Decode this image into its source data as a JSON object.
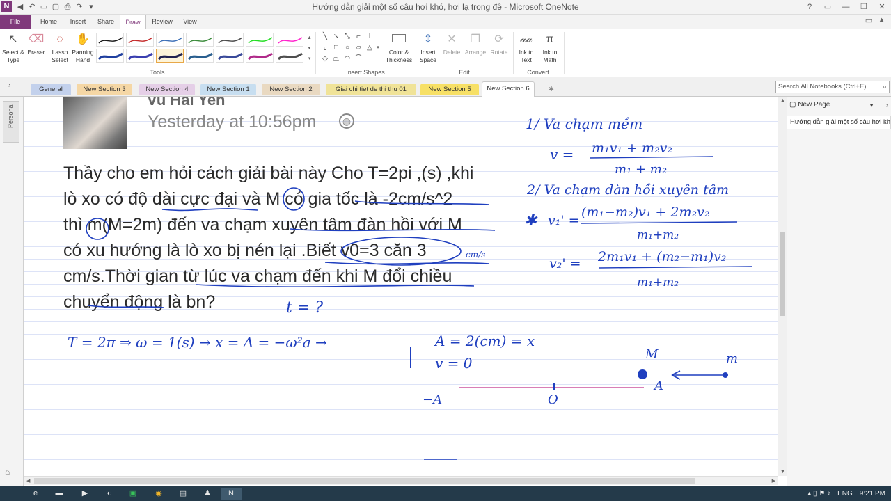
{
  "window": {
    "title": "Hướng dẫn giải một số câu hơi khó, hơi lạ trong đề - Microsoft OneNote",
    "app_logo": "N",
    "buttons": {
      "help": "?",
      "minimize": "—",
      "restore": "❐",
      "close": "✕"
    }
  },
  "quick_access": [
    "back-icon",
    "undo-icon",
    "dock-icon",
    "fullpage-icon",
    "print-icon",
    "redo-icon",
    "customize-icon"
  ],
  "ribbon_tabs": [
    "File",
    "Home",
    "Insert",
    "Share",
    "Draw",
    "Review",
    "View"
  ],
  "active_tab": "Draw",
  "ribbon": {
    "tools": {
      "select_type": "Select & Type",
      "eraser": "Eraser",
      "lasso_select": "Lasso Select",
      "panning_hand": "Panning Hand",
      "group_label": "Tools"
    },
    "insert_shapes": {
      "group_label": "Insert Shapes"
    },
    "color_thickness": "Color & Thickness",
    "edit": {
      "insert_space": "Insert Space",
      "delete": "Delete",
      "arrange": "Arrange",
      "rotate": "Rotate",
      "group_label": "Edit"
    },
    "convert": {
      "ink_to_text": "Ink to Text",
      "ink_to_math": "Ink to Math",
      "group_label": "Convert"
    },
    "pen_colors": [
      "#1a1a1a",
      "#c42b2b",
      "#3c6fb6",
      "#3a8a3a",
      "#4a4a4a",
      "#22dd22",
      "#ff22cc",
      "#1f3f9f",
      "#3a3fb0",
      "#22224f",
      "#2a5f8f",
      "#3a4a9a",
      "#b02b8a",
      "#4f4f4f"
    ]
  },
  "sections": {
    "tabs": [
      {
        "label": "General",
        "color": "#c3d1ec"
      },
      {
        "label": "New Section 3",
        "color": "#f5d7a5"
      },
      {
        "label": "New Section 4",
        "color": "#e5cfe7"
      },
      {
        "label": "New Section 1",
        "color": "#c7def0"
      },
      {
        "label": "New Section 2",
        "color": "#e9d9c1"
      },
      {
        "label": "Giai chi tiet de thi thu 01",
        "color": "#f0e398"
      },
      {
        "label": "New Section 5",
        "color": "#f7e066"
      },
      {
        "label": "New Section 6",
        "color": "#ffffff"
      }
    ],
    "active": "New Section 6",
    "search_placeholder": "Search All Notebooks (Ctrl+E)"
  },
  "notebook": {
    "name": "Personal"
  },
  "pages": {
    "new_page_label": "New Page",
    "items": [
      "Hướng dẫn giải một số câu hơi khó, hơi lạ trong đề"
    ]
  },
  "note": {
    "author": "Vu Hai Yen",
    "timestamp": "Yesterday at 10:56pm",
    "question_lines": [
      "Thầy cho em hỏi cách giải bài này Cho T=2pi ,(s) ,khi",
      "lò xo có độ dài cực đại và M có gia tốc là -2cm/s^2",
      "thì m(M=2m) đến va chạm xuyên tâm đàn hồi với M",
      "có xu hướng là lò xo bị nén lại .Biết v0=3 căn 3",
      "cm/s.Thời gian từ lúc va chạm đến khi M đổi chiều",
      "chuyển động là bn?"
    ],
    "handwriting": {
      "t_question": "t = ?",
      "solution_line": "T = 2π ⇒ ω = 1(s) → x = A = −ω²a →",
      "solution_A": "A = 2(cm) = x",
      "solution_v": "v = 0",
      "label_M": "M",
      "label_m": "m",
      "label_A_right": "A",
      "label_A_left": "−A",
      "label_O": "O",
      "formula1_title": "1/ Va chạm mềm",
      "formula1_lhs": "v =",
      "formula1_num": "m₁v₁ + m₂v₂",
      "formula1_den": "m₁ + m₂",
      "formula2_title": "2/ Va chạm đàn hồi xuyên tâm",
      "formula2a_lhs": "v₁' =",
      "formula2a_num": "(m₁−m₂)v₁ + 2m₂v₂",
      "formula2a_den": "m₁+m₂",
      "formula2b_lhs": "v₂' =",
      "formula2b_num": "2m₁v₁ + (m₂−m₁)v₂",
      "formula2b_den": "m₁+m₂",
      "star": "✱",
      "cms": "cm/s"
    }
  },
  "taskbar": {
    "items": [
      "start-icon",
      "ie-icon",
      "explorer-icon",
      "media-icon",
      "chrome-icon",
      "excel-icon",
      "chrome-icon-2",
      "app-icon",
      "app-icon-2",
      "onenote-icon"
    ],
    "language": "ENG",
    "time": "9:21 PM"
  }
}
